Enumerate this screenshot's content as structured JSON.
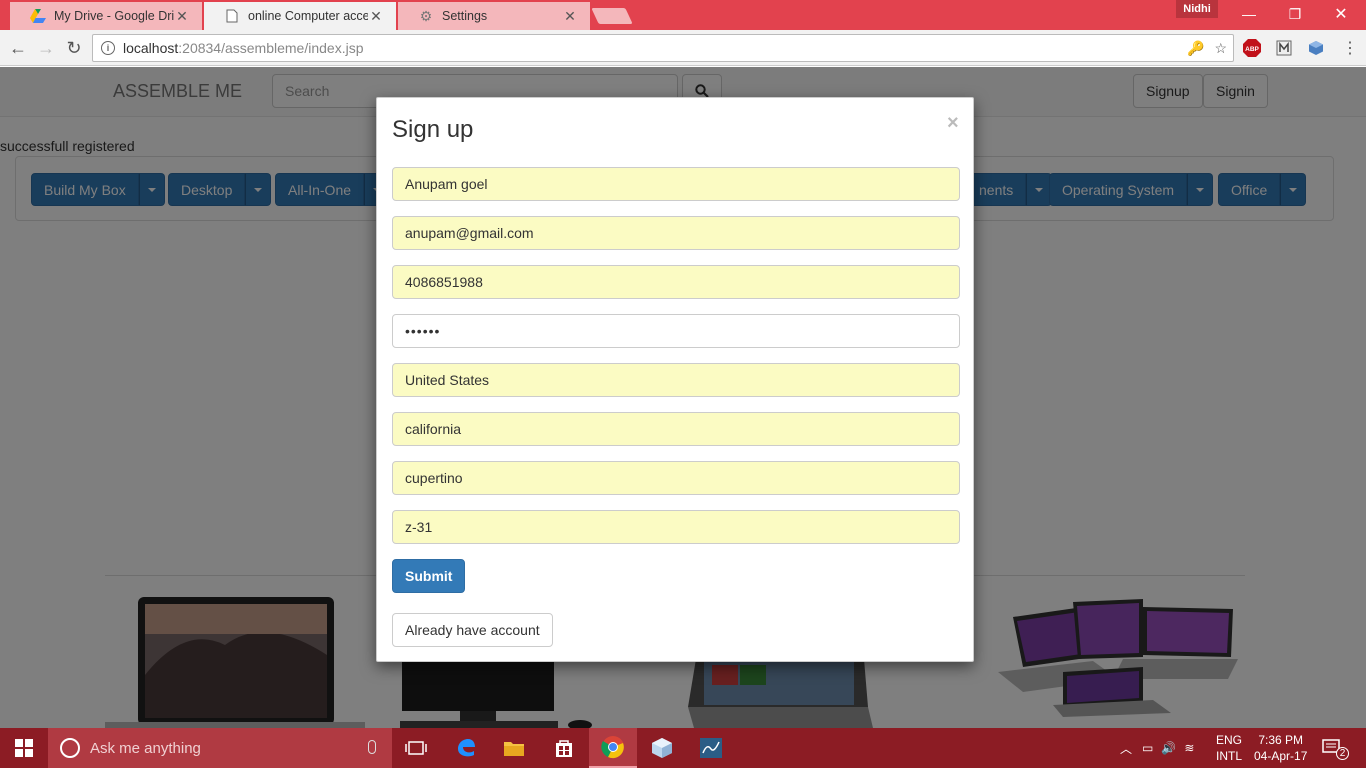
{
  "browser": {
    "tabs": [
      {
        "label": "My Drive - Google Drive",
        "icon": "google-drive-icon",
        "active": false
      },
      {
        "label": "online Computer accesso",
        "icon": "page-icon",
        "active": true
      },
      {
        "label": "Settings",
        "icon": "gear-icon",
        "active": false
      }
    ],
    "profile_name": "Nidhi",
    "url_host": "localhost",
    "url_path": ":20834/assembleme/index.jsp",
    "extensions": {
      "abp_label": "ABP"
    }
  },
  "site": {
    "brand": "ASSEMBLE ME",
    "search_placeholder": "Search",
    "signup_label": "Signup",
    "signin_label": "Signin",
    "flash_message": "successfull registered",
    "categories_left": [
      {
        "label": "Build My Box"
      },
      {
        "label": "Desktop"
      },
      {
        "label": "All-In-One"
      }
    ],
    "categories_right": [
      {
        "label": "nents"
      },
      {
        "label": "Operating System"
      },
      {
        "label": "Office"
      }
    ]
  },
  "modal": {
    "title": "Sign up",
    "close_glyph": "×",
    "fields": {
      "name": "Anupam goel",
      "email": "anupam@gmail.com",
      "phone": "4086851988",
      "password": "••••••",
      "country": "United States",
      "state": "california",
      "city": "cupertino",
      "zip": "z-31"
    },
    "submit_label": "Submit",
    "have_account_label": "Already have account"
  },
  "taskbar": {
    "search_placeholder": "Ask me anything",
    "lang_top": "ENG",
    "lang_bottom": "INTL",
    "time": "7:36 PM",
    "date": "04-Apr-17",
    "notification_count": "2"
  },
  "colors": {
    "chrome_frame": "#e2424e",
    "bootstrap_primary": "#337ab7",
    "autofill": "#fbfbc3",
    "taskbar": "#8c1c24"
  }
}
